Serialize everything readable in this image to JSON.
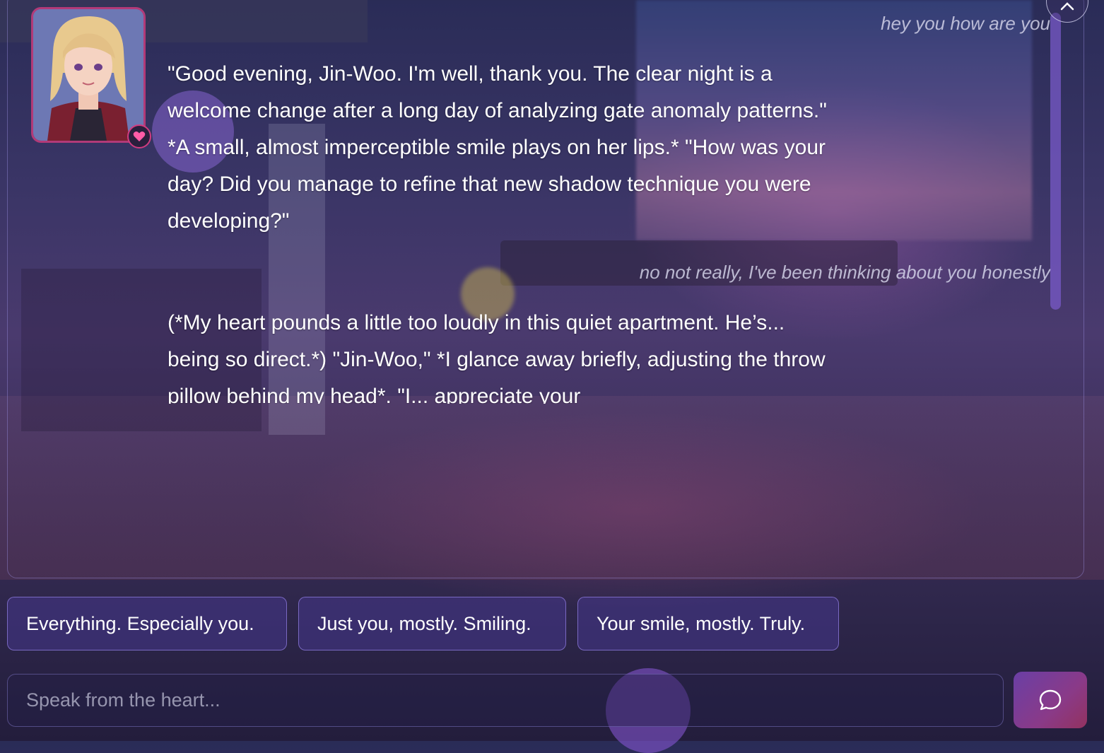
{
  "conversation": {
    "messages": [
      {
        "role": "user",
        "text": "hey you how are you"
      },
      {
        "role": "assistant",
        "text": "\"Good evening, Jin-Woo.  I'm well, thank you.  The clear night is a welcome change after a long day of analyzing gate anomaly patterns.\" *A small, almost imperceptible smile plays on her lips.* \"How was your day?  Did you manage to refine that new shadow technique you were developing?\""
      },
      {
        "role": "user",
        "text": "no not really, I've been thinking about you honestly"
      },
      {
        "role": "assistant",
        "text": "(*My heart pounds a little too loudly in this quiet apartment. He’s... being so direct.*)  \"Jin-Woo,\"  *I glance away briefly, adjusting the throw pillow behind my head*. \"I... appreciate your"
      }
    ]
  },
  "character": {
    "avatar_icon": "character-portrait",
    "badge_icon": "heart-icon",
    "accent_color": "#d13c80"
  },
  "suggestions": [
    "Everything. Especially you.",
    "Just you, mostly. Smiling.",
    "Your smile, mostly. Truly."
  ],
  "composer": {
    "placeholder": "Speak from the heart...",
    "value": "",
    "send_icon": "chat-bubble-icon"
  },
  "controls": {
    "close_icon": "close-icon"
  },
  "theme": {
    "chip_border": "#9682e6",
    "send_gradient": [
      "#6a3fa5",
      "#93325f"
    ]
  }
}
